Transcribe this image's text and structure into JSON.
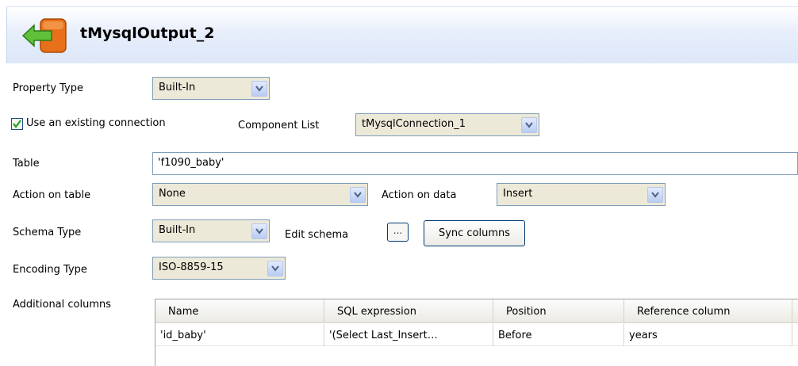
{
  "header": {
    "title": "tMysqlOutput_2",
    "icon": "component-arrow-icon"
  },
  "property_type": {
    "label": "Property Type",
    "value": "Built-In"
  },
  "use_connection": {
    "label": "Use an existing connection",
    "checked": true
  },
  "component_list": {
    "label": "Component List",
    "value": "tMysqlConnection_1"
  },
  "table": {
    "label": "Table",
    "value": "'f1090_baby'"
  },
  "action_on_table": {
    "label": "Action on table",
    "value": "None"
  },
  "action_on_data": {
    "label": "Action on data",
    "value": "Insert"
  },
  "schema_type": {
    "label": "Schema Type",
    "value": "Built-In"
  },
  "edit_schema": {
    "label": "Edit schema",
    "button": "..."
  },
  "sync_columns": {
    "label": "Sync columns"
  },
  "encoding_type": {
    "label": "Encoding Type",
    "value": "ISO-8859-15"
  },
  "additional_columns": {
    "label": "Additional columns",
    "headers": [
      "Name",
      "SQL expression",
      "Position",
      "Reference column"
    ],
    "rows": [
      [
        "'id_baby'",
        "'(Select Last_Insert…",
        "Before",
        "years"
      ]
    ]
  }
}
